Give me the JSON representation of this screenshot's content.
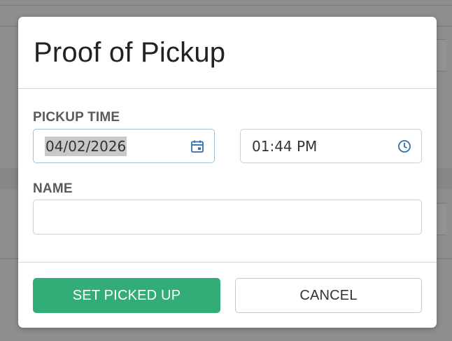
{
  "modal": {
    "title": "Proof of Pickup",
    "pickup_time": {
      "label": "PICKUP TIME",
      "date_value": "04/02/2026",
      "time_value": "01:44 PM",
      "date_icon": "calendar-icon",
      "time_icon": "clock-icon"
    },
    "name": {
      "label": "NAME",
      "value": "",
      "placeholder": ""
    },
    "buttons": {
      "confirm_label": "SET PICKED UP",
      "cancel_label": "CANCEL"
    }
  },
  "colors": {
    "primary_button": "#32ad78",
    "icon_blue": "#2f6fad",
    "focus_border": "#9dc3dc",
    "backdrop": "#8e8e8e"
  }
}
